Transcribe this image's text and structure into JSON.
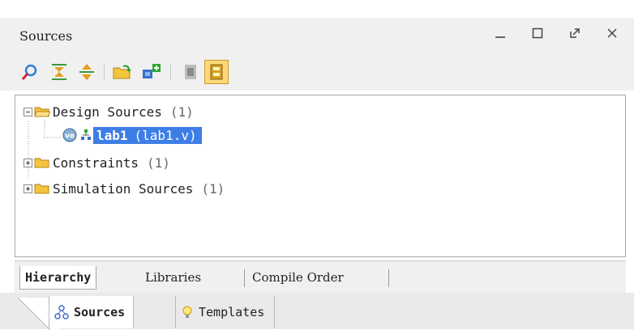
{
  "panel": {
    "title": "Sources",
    "controls": [
      "minimize",
      "maximize",
      "float",
      "close"
    ]
  },
  "toolbar": {
    "buttons": [
      {
        "icon": "search-icon"
      },
      {
        "icon": "collapse-all-icon"
      },
      {
        "icon": "expand-all-icon"
      },
      {
        "icon": "open-folder-icon"
      },
      {
        "icon": "add-sources-icon"
      },
      {
        "icon": "document-icon"
      },
      {
        "icon": "show-hierarchy-icon",
        "active": true
      }
    ]
  },
  "tree": {
    "items": [
      {
        "label": "Design Sources",
        "count": "(1)",
        "expanded": true
      },
      {
        "label": "lab1",
        "sub": "(lab1.v)",
        "selected": true
      },
      {
        "label": "Constraints",
        "count": "(1)",
        "expanded": false
      },
      {
        "label": "Simulation Sources",
        "count": "(1)",
        "expanded": false
      }
    ]
  },
  "view_tabs": [
    "Hierarchy",
    "Libraries",
    "Compile Order"
  ],
  "bottom_tabs": [
    "Sources",
    "Templates"
  ],
  "colors": {
    "selection": "#3d7ee6",
    "folder": "#f4c43c",
    "toolbar_active": "#ffd87a"
  }
}
